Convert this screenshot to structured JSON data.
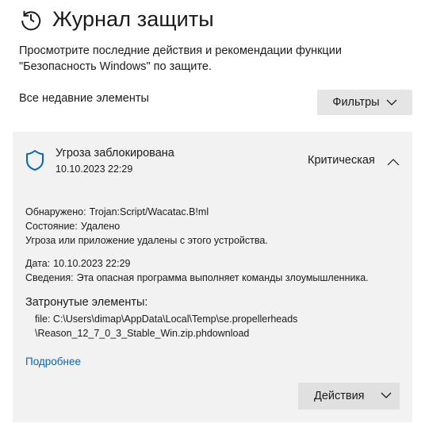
{
  "header": {
    "icon": "history-clock-icon",
    "title": "Журнал защиты"
  },
  "description": "Просмотрите последние действия и рекомендации функции \"Безопасность Windows\" по защите.",
  "list": {
    "section_label": "Все недавние элементы",
    "filters_label": "Фильтры"
  },
  "threat": {
    "icon": "shield-icon",
    "title": "Угроза заблокирована",
    "date": "10.10.2023 22:29",
    "severity": "Критическая",
    "detected_label": "Обнаружено:",
    "detected_value": "Trojan:Script/Wacatac.B!ml",
    "state_label": "Состояние:",
    "state_value": "Удалено",
    "state_message": "Угроза или приложение удалены с этого устройства.",
    "date_label": "Дата:",
    "date_value": "10.10.2023 22:29",
    "info_label": "Сведения:",
    "info_value": "Эта опасная программа выполняет команды злоумышленника.",
    "affected_title": "Затронутые элементы:",
    "file_line1": "file: C:\\Users\\dimap\\AppData\\Local\\Temp\\se.propellerheads",
    "file_line2": "\\Reason_12_7_0_3_Stable_Win.zip.phdownload",
    "more_link": "Подробнее",
    "actions_label": "Действия"
  },
  "colors": {
    "accent": "#0067c0",
    "shield": "#0067c0",
    "card_bg": "#f2f2f2",
    "button_bg": "#e5e5e5"
  }
}
